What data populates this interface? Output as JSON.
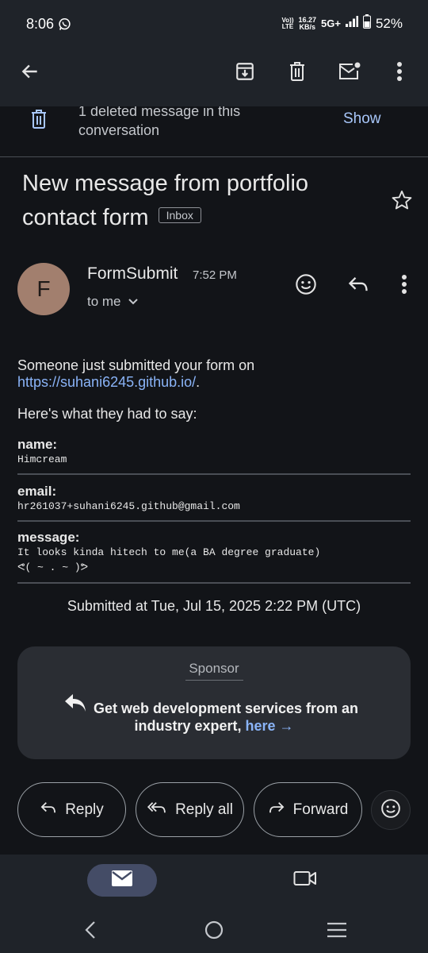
{
  "status_bar": {
    "time": "8:06",
    "volte": "Vo)) LTE",
    "net_speed_value": "16.27",
    "net_speed_unit": "KB/s",
    "network": "5G+",
    "battery": "52%"
  },
  "app_bar": {
    "icons": [
      "back-arrow-icon",
      "archive-icon",
      "trash-icon",
      "mark-unread-icon",
      "more-vert-icon"
    ]
  },
  "deleted_notice": {
    "text_line1": "1 deleted message in this",
    "text_line2": "conversation",
    "show_label": "Show"
  },
  "email": {
    "subject": "New message from portfolio contact form",
    "label": "Inbox",
    "avatar_letter": "F",
    "sender": "FormSubmit",
    "time": "7:52 PM",
    "recipient": "to me",
    "intro_line1": "Someone just submitted your form on",
    "form_url": "https://suhani6245.github.io/",
    "url_suffix": ".",
    "prompt": "Here's what they had to say:",
    "fields": [
      {
        "label": "name:",
        "value": "Himcream"
      },
      {
        "label": "email:",
        "value": "hr261037+suhani6245.github@gmail.com"
      },
      {
        "label": "message:",
        "value_line1": "It looks kinda hitech to me(a BA degree graduate)",
        "value_line2": "ᕙ( ~ . ~ )ᕗ"
      }
    ],
    "submitted": "Submitted at Tue, Jul 15, 2025 2:22 PM (UTC)"
  },
  "sponsor": {
    "title": "Sponsor",
    "text_line1": "Get web development services from an",
    "text_line2": "industry expert,",
    "link_text": "here →"
  },
  "actions": {
    "reply": "Reply",
    "reply_all": "Reply all",
    "forward": "Forward"
  },
  "colors": {
    "background": "#121418",
    "surface": "#1f2329",
    "link": "#8ab4f8",
    "avatar": "#a27f6e"
  }
}
